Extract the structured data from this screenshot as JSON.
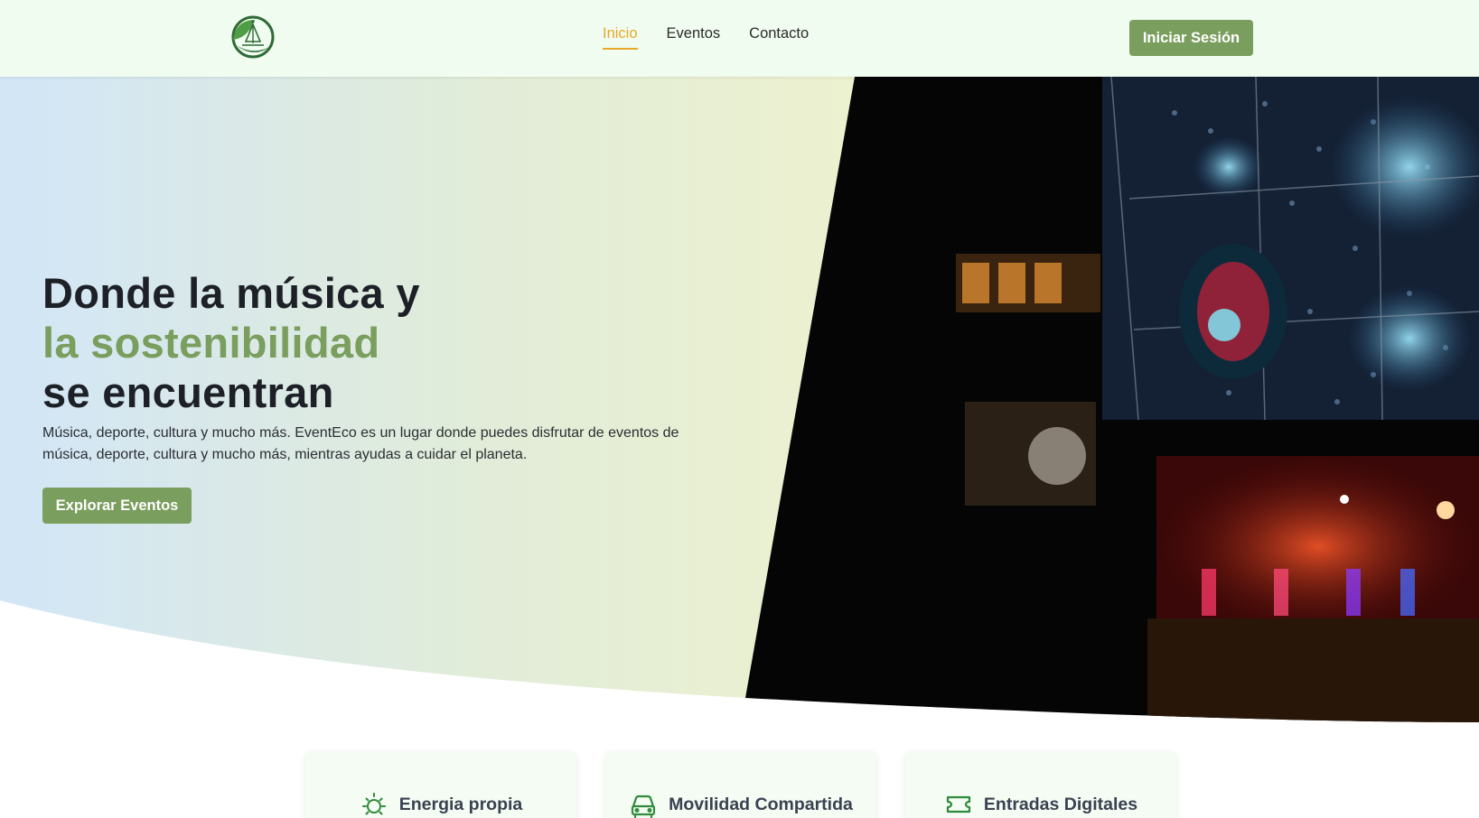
{
  "brand": {
    "logo_icon": "leaf-globe-logo-icon"
  },
  "nav": {
    "links": [
      {
        "label": "Inicio",
        "active": true
      },
      {
        "label": "Eventos",
        "active": false
      },
      {
        "label": "Contacto",
        "active": false
      }
    ],
    "login_label": "Iniciar Sesión"
  },
  "hero": {
    "title_line1": "Donde la música y",
    "title_line2": "la sostenibilidad",
    "title_line3": "se encuentran",
    "description": "Música, deporte, cultura y mucho más. EventEco es un lugar donde puedes disfrutar de eventos de música, deporte, cultura y mucho más, mientras ayudas a cuidar el planeta.",
    "cta_label": "Explorar Eventos",
    "image_description": "aerial night concert image"
  },
  "features": [
    {
      "label": "Energia propia",
      "icon": "sun-icon"
    },
    {
      "label": "Movilidad Compartida",
      "icon": "car-icon"
    },
    {
      "label": "Entradas Digitales",
      "icon": "ticket-icon"
    }
  ],
  "colors": {
    "accent_green": "#7a9e5e",
    "active_link": "#e6a72a",
    "nav_bg": "#f1fcf0",
    "icon_green": "#2f8a3a"
  }
}
